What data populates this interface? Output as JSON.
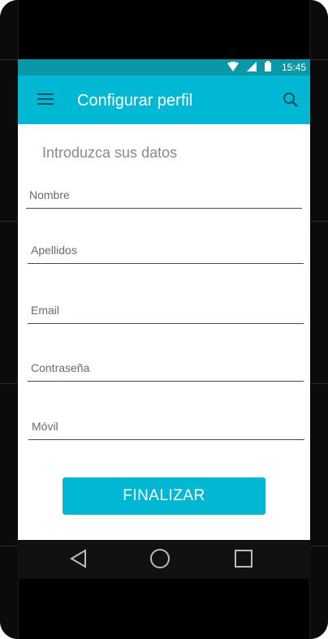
{
  "statusbar": {
    "time": "15:45"
  },
  "appbar": {
    "title": "Configurar perfil"
  },
  "form": {
    "subtitle": "Introduzca sus datos",
    "fields": [
      {
        "placeholder": "Nombre"
      },
      {
        "placeholder": "Apellidos"
      },
      {
        "placeholder": "Email"
      },
      {
        "placeholder": "Contraseña"
      },
      {
        "placeholder": "Móvil"
      }
    ],
    "submit_label": "FINALIZAR"
  },
  "colors": {
    "appbar": "#00b8d4",
    "statusbar": "#0a97a8",
    "button": "#00b8d4"
  },
  "icons": [
    "menu-icon",
    "search-icon",
    "wifi-icon",
    "signal-icon",
    "battery-icon",
    "back-icon",
    "home-icon",
    "recents-icon"
  ]
}
